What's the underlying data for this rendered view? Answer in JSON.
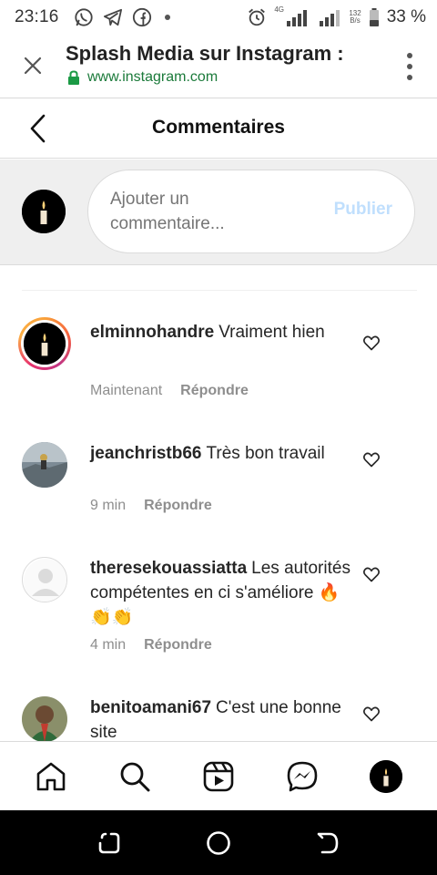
{
  "status_bar": {
    "time": "23:16",
    "net_speed_value": "132",
    "net_speed_unit": "B/s",
    "network_type": "4G",
    "battery": "33 %",
    "app_icons": [
      "whatsapp-icon",
      "telegram-icon",
      "facebook-icon"
    ]
  },
  "tab": {
    "title": "Splash Media sur Instagram :",
    "url": "www.instagram.com"
  },
  "page": {
    "title": "Commentaires"
  },
  "composer": {
    "placeholder": "Ajouter un commentaire...",
    "publish_label": "Publier"
  },
  "comments": [
    {
      "username": "elminnohandre",
      "text": "Vraiment hien",
      "time": "Maintenant",
      "reply_label": "Répondre",
      "has_story_ring": true,
      "avatar": "candle"
    },
    {
      "username": "jeanchristb66",
      "text": "Très bon travail",
      "time": "9 min",
      "reply_label": "Répondre",
      "has_story_ring": false,
      "avatar": "landscape"
    },
    {
      "username": "theresekouassiatta",
      "text": "Les autorités compétentes en ci s'améliore 🔥👏👏",
      "time": "4 min",
      "reply_label": "Répondre",
      "has_story_ring": false,
      "avatar": "default"
    },
    {
      "username": "benitoamani67",
      "text": "C'est une bonne site",
      "time": "",
      "reply_label": "",
      "has_story_ring": false,
      "avatar": "portrait"
    }
  ],
  "colors": {
    "link_green": "#1b7a3a",
    "publish_disabled": "#c0dffd",
    "muted_text": "#8e8e8e"
  }
}
